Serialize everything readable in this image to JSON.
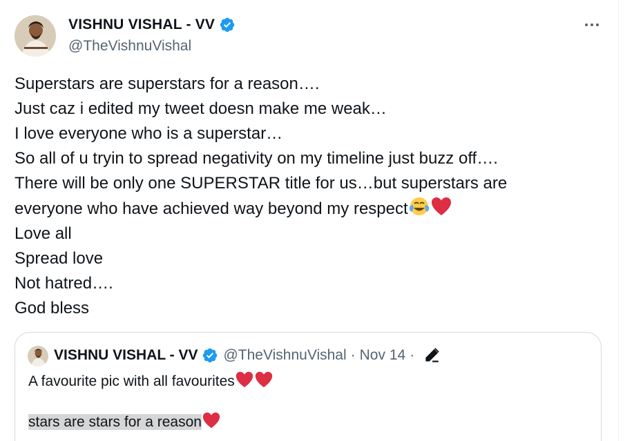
{
  "author": {
    "display_name": "VISHNU VISHAL - VV",
    "handle": "@TheVishnuVishal"
  },
  "tweet": {
    "lines": [
      "Superstars are superstars for a reason….",
      "Just caz i edited my tweet doesn make me weak…",
      "I love everyone who is a superstar…",
      "So all of u tryin to spread negativity on my timeline just buzz off….",
      "There will be only one SUPERSTAR title for us…but superstars are",
      "everyone who have achieved way beyond my respect",
      "Love all",
      "Spread love",
      "Not hatred….",
      "God bless"
    ]
  },
  "quote": {
    "display_name": "VISHNU VISHAL - VV",
    "handle": "@TheVishnuVishal",
    "separator": "·",
    "date": "Nov 14",
    "text": "A favourite pic with all favourites",
    "text_line2": "stars are stars for a reason"
  },
  "icons": {
    "verified": "verified-badge-icon",
    "more": "more-options-icon",
    "edit": "edited-pencil-icon",
    "laugh_cry": "face-with-tears-of-joy-emoji",
    "heart": "red-heart-emoji"
  },
  "colors": {
    "verified_blue": "#1d9bf0",
    "text_primary": "#0f1419",
    "text_secondary": "#536471",
    "border": "#cfd9de",
    "heart_red": "#dd2e44",
    "highlight": "#d6d6d6"
  }
}
